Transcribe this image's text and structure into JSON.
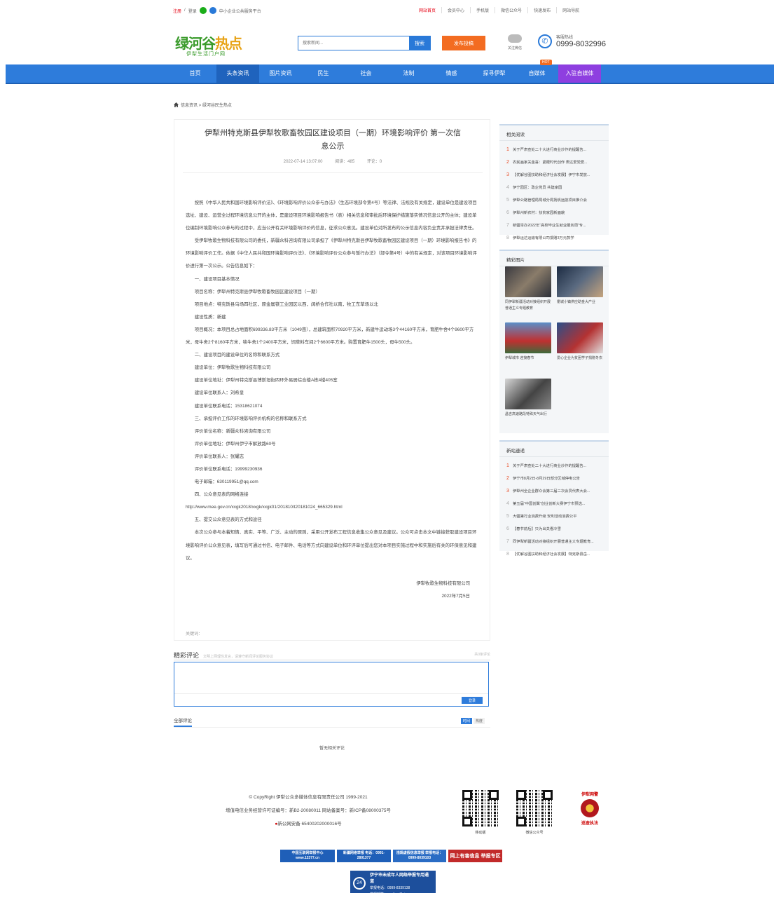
{
  "topbar": {
    "login": "注册",
    "sep": "/",
    "register": "登录",
    "platform": "中小企业公共服务平台",
    "links": [
      "网站首页",
      "会员中心",
      "手机版",
      "微信公众号",
      "快速发布",
      "网站导航"
    ]
  },
  "header": {
    "logo_main_1": "绿河谷",
    "logo_main_2": "热点",
    "logo_sub": "伊犁生活门户网",
    "search_placeholder": "搜索新闻...",
    "search_button": "搜索",
    "post_button": "发布投稿",
    "wechat_label": "关注微信",
    "hotline_label": "客服热线",
    "hotline_number": "0999-8032996"
  },
  "nav": {
    "items": [
      "首页",
      "头条资讯",
      "图片资讯",
      "民生",
      "社会",
      "法制",
      "情感",
      "探寻伊犁",
      "自媒体",
      "入驻自媒体"
    ],
    "hot_badge": "HOT"
  },
  "breadcrumb": {
    "text": "信息资讯 > 绿河谷民生热点"
  },
  "article": {
    "title": "伊犁州特克斯县伊犁牧歌畜牧园区建设项目（一期）环境影响评价 第一次信息公示",
    "date": "2022-07-14 13:07:00",
    "views": "阅读：485",
    "comments": "评论：0",
    "paragraphs": [
      "按照《中华人民共和国环境影响评价法》、《环境影响评价公众参与办法》（生态环境部令第4号）等法律、法规及有关规定，建设单位是建设项目选址、建设、运营全过程环境信息公开的主体，是建设项目环境影响报告书（表）相关信息和审批后环境保护措施落实情况信息公开的主体；建设单位编制环境影响公众参与的过程中，应当公开有关环境影响评价的信息，征求公众意见。建设单位对所发布的公示信息内容负全责并承担法律责任。",
      "受伊犁牧歌生物科技有限公司的委托，新疆众科咨询有限公司承担了《伊犁州特克斯县伊犁牧歌畜牧园区建设项目（一期）环境影响报告书》的环境影响评价工作。依据《中华人民共和国环境影响评价法》、《环境影响评价公众参与暂行办法》（部令第4号）中的有关规定，对该项目环境影响评价进行第一次公示。公告信息如下：",
      "一、建设项目基本情况",
      "项目名称：伊犁州特克斯县伊犁牧歌畜牧园区建设项目（一期）",
      "项目地点：特克斯县乌场四社区，原金属镁工业园区以西，阔桥合作社以南，牧工东草场以北",
      "建设性质：新建",
      "项目概况：本项目总占地面积699336.83平方米（1049亩），总建筑面积70920平方米，新建牛运动场3个44160平方米，育肥牛舍4个9600平方米，母牛舍2个8160平方米，犊牛舍1个2400平方米，饲草料车间2个6600平方米。购置育肥牛1500头，母牛500头。",
      "二、建设项目的建设单位的名称和联系方式",
      "建设单位：伊犁牧歌生物科技有限公司",
      "建设单位地址：伊犁州特克斯县博斯坦街四环外易居综合楼A栋4楼405室",
      "建设单位联系人：刘希皇",
      "建设单位联系电话：15318621074",
      "三、承担评价工作的环境影响评价机构的名称和联系方式",
      "评价单位名称：新疆众科咨询有限公司",
      "评价单位地址：伊犁州伊宁市解放路60号",
      "评价单位联系人：张耀志",
      "评价单位联系电话：19999230936",
      "电子邮箱：630119951@qq.com",
      "四、公众意见表的网络连接"
    ],
    "url": "http://www.mee.gov.cn/xxgk2018/xxgk/xxgk01/201810/t20181024_665329.html",
    "paragraphs2": [
      "五、提交公众意见表的方式和途径",
      "本次公众参与本着知情、真实、平等、广泛、主动的原则，采用公开发布工程信息收集公众意见及建议。公众可点击本文中链接获取建设项目环境影响评价公众意见表，填写后可通过书信、电子邮件、电话等方式向建设单位和环评单位提出您对本项目实施过程中和实施后有关的环保意见和建议。"
    ],
    "sign_company": "伊犁牧歌生物科技有限公司",
    "sign_date": "2022年7月5日",
    "keywords": "关键词："
  },
  "comments": {
    "title": "精彩评论",
    "tip": "文明上网理性发言，请遵守新闻评论服务协议",
    "right": "共0条评论",
    "submit": "登录",
    "all_label": "全部评论",
    "sort_new": "时间",
    "sort_hot": "热度",
    "empty": "暂无相关评论"
  },
  "sidebar": {
    "related_title": "相关阅读",
    "related": [
      "关于严肃查处二十大进行商业炒作的提醒告...",
      "农民画家关金喜：紧跟时代创作 表达爱党爱...",
      "【优解谷图扶助和经济社会发展】伊宁市发放...",
      "伊宁园区：政企党员 共建家园",
      "伊犁公路管理局局城分局扬帆远航项目推介会",
      "伊犁州新农村：扶贫家园新面貌",
      "新疆举办2022年“高校毕业生就业服务周”专...",
      "伊犁运达运输有限公司捐赠3万元款学"
    ],
    "pics_title": "精彩图片",
    "pics": [
      "同伊犁新疆活动对接组织开展普通主义专题教育",
      "霍城小镇供应助金大产业",
      "伊犁城市 迎接春节",
      "爱心企业为贫困学子捐赠冬衣",
      "昌吉高速路段特殊天气出行"
    ],
    "news_title": "新站速递",
    "news": [
      "关于严肃查处二十大进行商业炒作的提醒告...",
      "伊宁市8月2日-8月29日部分区域停电公告",
      "伊犁州全企业群众会第三届二次会员代表大会...",
      "第五届“中国创翼”创业创新大赛伊宁市预选...",
      "大疆第行业消费升级 安利活动消费公平",
      "【春节前后】只为出关看冷雪",
      "同伊犁新疆活动对接组织开展普通主义专题教育...",
      "【优解谷图扶助和经济社会发展】特克斯县岳..."
    ]
  },
  "footer": {
    "copyright": "© CopyRight 伊犁公众多媒体信息有限责任公司 1999-2021",
    "license": "增值电信业务经营许可证编号：新B2-20080011 网站备案号：新ICP备08000375号",
    "police": "新公网安备 65400202000016号",
    "qr1": "移动版",
    "qr2": "微信公众号",
    "police_badge_top": "伊犁网警",
    "police_badge_bottom": "巡查执法",
    "banners": [
      "中国互联网举报中心 www.12377.cn",
      "新疆网络举报 电话：0991-2801377",
      "违规虚假信息举报 举报电话：0999-8039103",
      "网上有害信息 举报专区"
    ],
    "minor_title": "伊宁市未成年人网络举报专用通道",
    "minor_phone": "举报电话：0999-8339138",
    "minor_mail": "举报邮箱：ynsjbzx@sina.com"
  }
}
